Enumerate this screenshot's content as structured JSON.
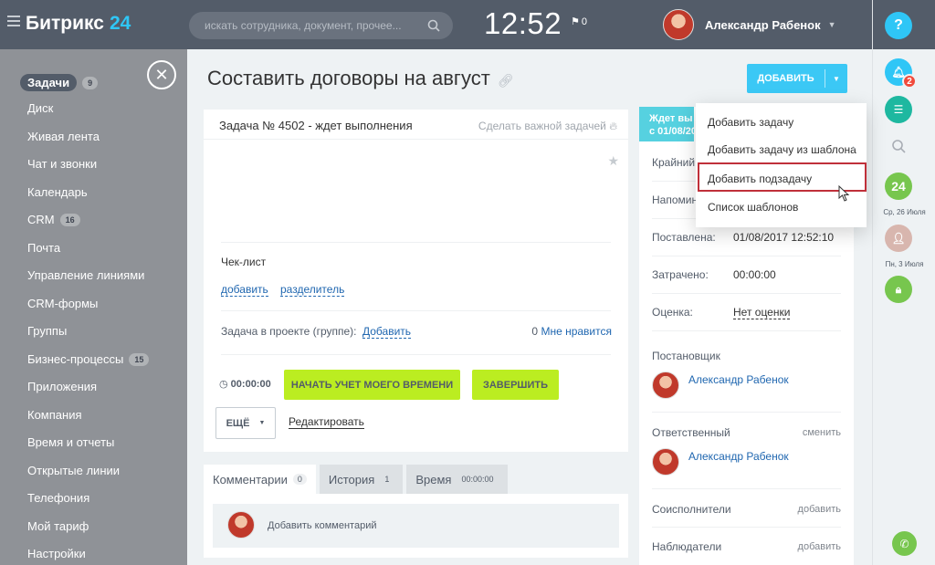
{
  "header": {
    "logo": "Битрикс",
    "logo_num": "24",
    "search_placeholder": "искать сотрудника, документ, прочее...",
    "clock": "12:52",
    "flag_count": "0",
    "user_name": "Александр Рабенок"
  },
  "sidebar": {
    "items": [
      {
        "label": "Задачи",
        "count": "9"
      },
      {
        "label": "Диск"
      },
      {
        "label": "Живая лента"
      },
      {
        "label": "Чат и звонки"
      },
      {
        "label": "Календарь"
      },
      {
        "label": "CRM",
        "count": "16"
      },
      {
        "label": "Почта"
      },
      {
        "label": "Управление линиями"
      },
      {
        "label": "CRM-формы"
      },
      {
        "label": "Группы"
      },
      {
        "label": "Бизнес-процессы",
        "count": "15"
      },
      {
        "label": "Приложения"
      },
      {
        "label": "Компания"
      },
      {
        "label": "Время и отчеты"
      },
      {
        "label": "Открытые линии"
      },
      {
        "label": "Телефония"
      },
      {
        "label": "Мой тариф"
      },
      {
        "label": "Настройки"
      }
    ]
  },
  "main": {
    "title": "Составить договоры на август",
    "add_button": "ДОБАВИТЬ",
    "task_header": "Задача № 4502 - ждет выполнения",
    "make_important": "Сделать важной задачей",
    "checklist_label": "Чек-лист",
    "checklist_add": "добавить",
    "checklist_separator": "разделитель",
    "project_label": "Задача в проекте (группе):",
    "project_add": "Добавить",
    "likes_count": "0",
    "likes_label": "Мне нравится",
    "timer": "00:00:00",
    "start_timer_button": "НАЧАТЬ УЧЕТ МОЕГО ВРЕМЕНИ",
    "finish_button": "ЗАВЕРШИТЬ",
    "more_button": "ЕЩЁ",
    "edit_link": "Редактировать",
    "tabs": [
      {
        "label": "Комментарии",
        "count": "0"
      },
      {
        "label": "История",
        "count": "1"
      },
      {
        "label": "Время",
        "count": "00:00:00"
      }
    ],
    "add_comment": "Добавить комментарий"
  },
  "side": {
    "status_line1": "Ждет вы",
    "status_line2": "с 01/08/20",
    "deadline_label": "Крайний",
    "reminder_label": "Напомин",
    "created_label": "Поставлена:",
    "created_value": "01/08/2017 12:52:10",
    "spent_label": "Затрачено:",
    "spent_value": "00:00:00",
    "rating_label": "Оценка:",
    "rating_value": "Нет оценки",
    "creator_label": "Постановщик",
    "creator_name": "Александр Рабенок",
    "responsible_label": "Ответственный",
    "responsible_change": "сменить",
    "responsible_name": "Александр Рабенок",
    "accomplices_label": "Соисполнители",
    "accomplices_add": "добавить",
    "auditors_label": "Наблюдатели",
    "auditors_add": "добавить"
  },
  "menu": {
    "items": [
      "Добавить задачу",
      "Добавить задачу из шаблона",
      "Добавить подзадачу",
      "Список шаблонов"
    ],
    "highlighted": "Добавить подзадачу"
  },
  "rightbar": {
    "help": "?",
    "notifications": "2",
    "day": "24",
    "date1": "Ср, 26 Июля",
    "date2": "Пн, 3 Июля"
  },
  "colors": {
    "accent": "#3bc8f5",
    "green": "#bbed21",
    "highlight": "#c0303a"
  }
}
